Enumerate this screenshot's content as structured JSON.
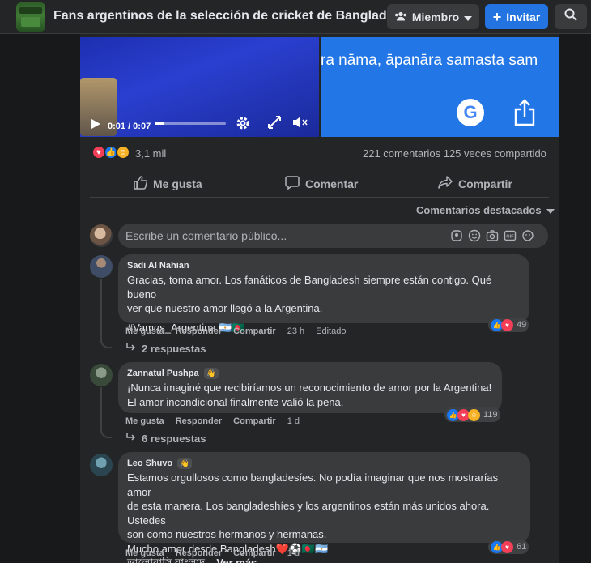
{
  "header": {
    "group_name": "Fans argentinos de la selección de cricket de Bangladesh",
    "member_label": "Miembro",
    "invite_label": "Invitar"
  },
  "video": {
    "time": "0:01 / 0:07",
    "progress_fraction": 0.14
  },
  "translation_panel": {
    "text": "ra nāma, āpanāra samasta sam"
  },
  "stats": {
    "reactions_count": "3,1 mil",
    "comments_shares": "221 comentarios  125 veces compartido"
  },
  "actions": {
    "like": "Me gusta",
    "comment": "Comentar",
    "share": "Compartir"
  },
  "featured_label": "Comentarios destacados",
  "composer": {
    "placeholder": "Escribe un comentario público..."
  },
  "comments": [
    {
      "author": "Sadi Al Nahian",
      "text": "Gracias, toma amor. Los fanáticos de Bangladesh siempre están contigo. Qué bueno\nver que nuestro amor llegó a la Argentina.",
      "hashtag": "#Vamos_Argentina 🇦🇷🇧🇩",
      "like": "Me gusta",
      "reply": "Responder",
      "share": "Compartir",
      "time": "23 h",
      "edited": "Editado",
      "reaction_count": "49",
      "replies": "2 respuestas"
    },
    {
      "author": "Zannatul Pushpa",
      "text": "¡Nunca imaginé que recibiríamos un reconocimiento de amor por la Argentina!\nEl amor incondicional finalmente valió la pena.",
      "like": "Me gusta",
      "reply": "Responder",
      "share": "Compartir",
      "time": "1 d",
      "reaction_count": "119",
      "replies": "6 respuestas"
    },
    {
      "author": "Leo Shuvo",
      "text": "Estamos orgullosos como bangladesíes. No podía imaginar que nos mostrarías amor\nde esta manera. Los bangladeshíes y los argentinos están más unidos ahora. Ustedes\nson como nuestros hermanos y hermanas.\nMucho amor desde Bangladesh❤️⚽🇧🇩🇦🇷",
      "tail_text": "ভালোবাসি বাংলাদ... ",
      "see_more": "Ver más",
      "like": "Me gusta",
      "reply": "Responder",
      "share": "Compartir",
      "time": "1 d",
      "reaction_count": "61"
    }
  ],
  "colors": {
    "background": "#18191a",
    "card": "#242526",
    "bubble": "#3a3b3c",
    "accent": "#2374e1",
    "like_blue": "#1877f2",
    "love_red": "#f33e58",
    "care_yellow": "#f7b125"
  }
}
